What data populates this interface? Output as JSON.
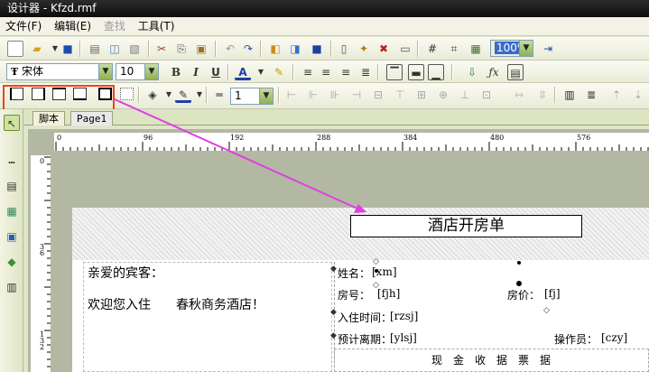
{
  "window": {
    "title": "设计器 - Kfzd.rmf"
  },
  "menu": {
    "file": "文件(F)",
    "edit": "编辑(E)",
    "find": "查找",
    "tools": "工具(T)"
  },
  "toolbar": {
    "font_name": "宋体",
    "font_size": "10",
    "zoom": "100%",
    "line_width": "1",
    "bold": "B",
    "italic": "I",
    "underline": "U",
    "text_color": "A"
  },
  "tabs": {
    "script": "脚本",
    "page1": "Page1"
  },
  "ruler": {
    "h": [
      "0",
      "96",
      "192",
      "288",
      "384",
      "480",
      "576"
    ],
    "v": [
      "0",
      "3 6",
      "1 3 2"
    ]
  },
  "report": {
    "title": "酒店开房单",
    "greeting": "亲爱的宾客：",
    "welcome": "欢迎您入住　　春秋商务酒店！",
    "fields": [
      {
        "label": "姓名：",
        "value": "[xm]"
      },
      {
        "label": "房号：",
        "value": "[fjh]"
      },
      {
        "label": "房价：",
        "value": "[fj]"
      },
      {
        "label": "入住时间：",
        "value": "[rzsj]"
      },
      {
        "label": "预计离期：",
        "value": "[ylsj]"
      },
      {
        "label": "操作员：",
        "value": "[czy]"
      }
    ],
    "footer": "现　金　收　据　票　据"
  },
  "colors": {
    "highlight_box": "#e8461c",
    "arrow": "#e040e0"
  }
}
